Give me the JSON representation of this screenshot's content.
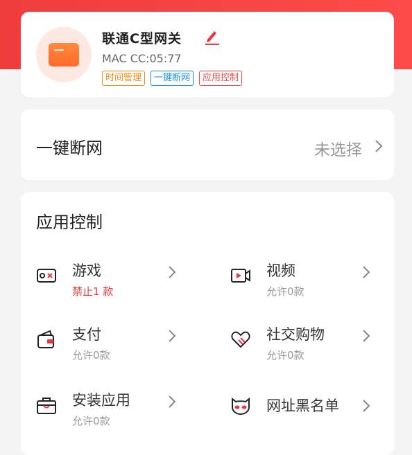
{
  "device": {
    "name": "联通C型网关",
    "mac": "MAC CC:05:77",
    "tags": [
      "时间管理",
      "一键断网",
      "应用控制"
    ]
  },
  "oneclick": {
    "title": "一键断网",
    "value": "未选择"
  },
  "appctrl": {
    "title": "应用控制",
    "items": [
      {
        "label": "游戏",
        "sub": "禁止1 款",
        "icon": "gamepad-icon"
      },
      {
        "label": "视频",
        "sub": "允许0款",
        "icon": "video-icon"
      },
      {
        "label": "支付",
        "sub": "允许0款",
        "icon": "wallet-icon"
      },
      {
        "label": "社交购物",
        "sub": "允许0款",
        "icon": "heart-handshake-icon"
      },
      {
        "label": "安装应用",
        "sub": "允许0款",
        "icon": "briefcase-icon"
      },
      {
        "label": "网址黑名单",
        "sub": "",
        "icon": "mask-icon"
      }
    ]
  },
  "colors": {
    "brand_red": "#f03c3c",
    "warn_red": "#e8383d",
    "tag_orange": "#ff8a16",
    "tag_blue": "#1a8fe0"
  }
}
